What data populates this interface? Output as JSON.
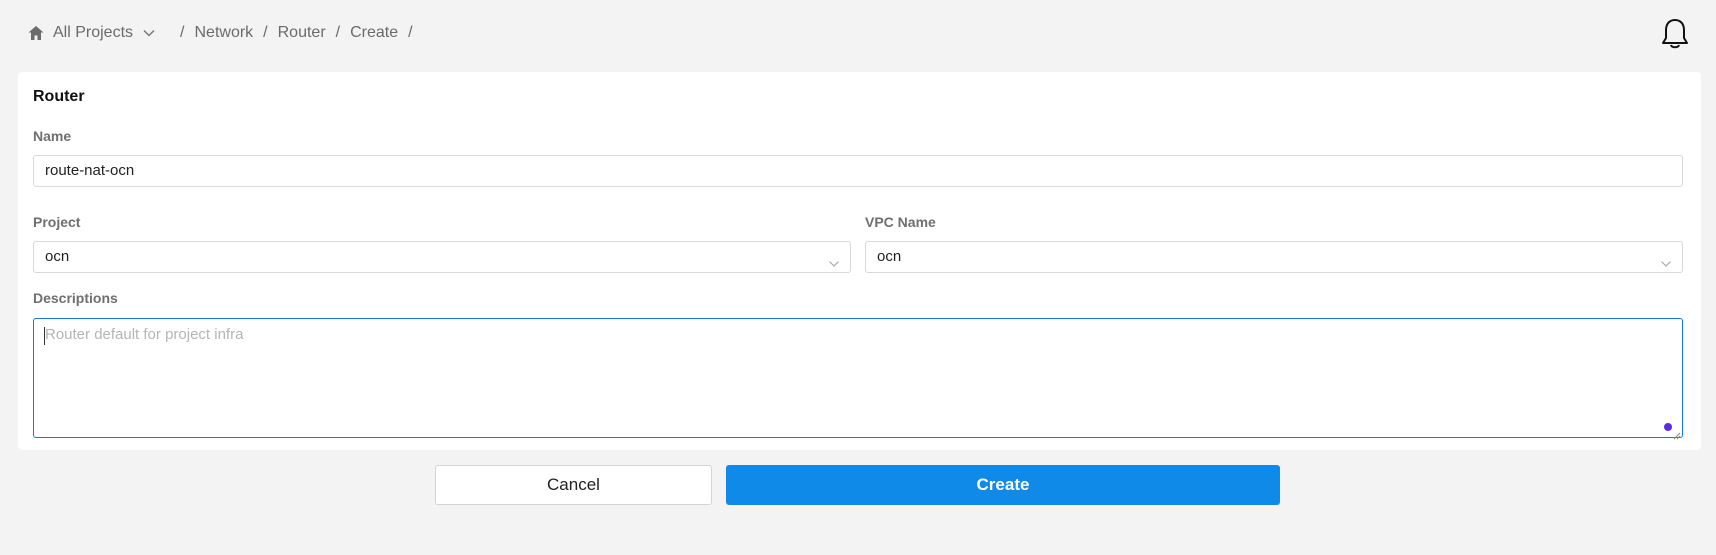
{
  "breadcrumb": {
    "project_selector": "All Projects",
    "items": [
      "Network",
      "Router",
      "Create"
    ],
    "separator": "/"
  },
  "icons": {
    "home": "home-icon",
    "chevron": "chevron-down-icon",
    "bell": "bell-icon"
  },
  "form": {
    "title": "Router",
    "name": {
      "label": "Name",
      "value": "route-nat-ocn"
    },
    "project": {
      "label": "Project",
      "value": "ocn"
    },
    "vpc": {
      "label": "VPC Name",
      "value": "ocn"
    },
    "descriptions": {
      "label": "Descriptions",
      "placeholder": "Router default for project infra"
    }
  },
  "actions": {
    "cancel_label": "Cancel",
    "create_label": "Create"
  },
  "colors": {
    "primary": "#0f8ae8",
    "focus_border": "#1677dd",
    "background": "#f3f3f3"
  }
}
